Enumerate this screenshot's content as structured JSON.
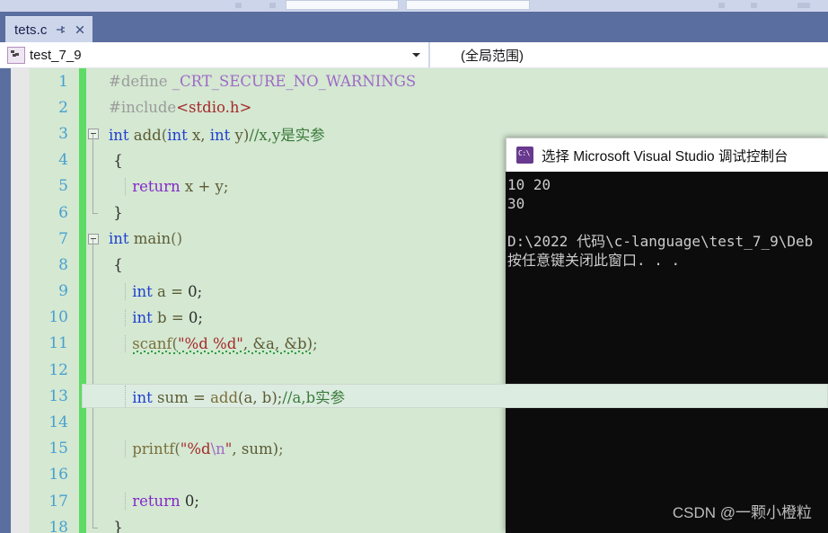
{
  "toolbar": {
    "visible_hint": "partial-toolbar-strip"
  },
  "tab": {
    "label": "tets.c",
    "pin_icon": "pin-icon",
    "close_icon": "close-icon"
  },
  "navbar": {
    "scope_left": "test_7_9",
    "scope_right": "(全局范围)",
    "member_icon": "member-icon",
    "caret_icon": "chevron-down-icon"
  },
  "editor": {
    "lines": [
      {
        "num": "1",
        "changed": true,
        "fold": "none",
        "indent_guides": 0,
        "tokens": [
          {
            "t": "#define ",
            "c": "c-pre"
          },
          {
            "t": "_CRT_SECURE_NO_WARNINGS",
            "c": "c-macro"
          }
        ]
      },
      {
        "num": "2",
        "changed": true,
        "fold": "none",
        "indent_guides": 0,
        "tokens": [
          {
            "t": "#include",
            "c": "c-pre"
          },
          {
            "t": "<stdio.h>",
            "c": "c-inc"
          }
        ]
      },
      {
        "num": "3",
        "changed": true,
        "fold": "open",
        "indent_guides": 0,
        "tokens": [
          {
            "t": "int ",
            "c": "c-kw"
          },
          {
            "t": "add",
            "c": "c-id"
          },
          {
            "t": "(",
            "c": "c-punct"
          },
          {
            "t": "int ",
            "c": "c-kw"
          },
          {
            "t": "x, ",
            "c": "c-id"
          },
          {
            "t": "int ",
            "c": "c-kw"
          },
          {
            "t": "y)",
            "c": "c-id"
          },
          {
            "t": "//x,y是实参",
            "c": "c-cmt"
          }
        ]
      },
      {
        "num": "4",
        "changed": true,
        "fold": "body",
        "indent_guides": 0,
        "tokens": [
          {
            "t": " {",
            "c": "c-plain"
          }
        ]
      },
      {
        "num": "5",
        "changed": true,
        "fold": "body",
        "indent_guides": 1,
        "tokens": [
          {
            "t": "     ",
            "c": "c-plain"
          },
          {
            "t": "return ",
            "c": "c-kwv"
          },
          {
            "t": "x + y;",
            "c": "c-id"
          }
        ]
      },
      {
        "num": "6",
        "changed": true,
        "fold": "end",
        "indent_guides": 0,
        "tokens": [
          {
            "t": " }",
            "c": "c-plain"
          }
        ]
      },
      {
        "num": "7",
        "changed": true,
        "fold": "open",
        "indent_guides": 0,
        "tokens": [
          {
            "t": "int ",
            "c": "c-kw"
          },
          {
            "t": "main",
            "c": "c-id"
          },
          {
            "t": "()",
            "c": "c-punct"
          }
        ]
      },
      {
        "num": "8",
        "changed": true,
        "fold": "body",
        "indent_guides": 0,
        "tokens": [
          {
            "t": " {",
            "c": "c-plain"
          }
        ]
      },
      {
        "num": "9",
        "changed": true,
        "fold": "body",
        "indent_guides": 1,
        "tokens": [
          {
            "t": "     ",
            "c": "c-plain"
          },
          {
            "t": "int ",
            "c": "c-kw"
          },
          {
            "t": "a = ",
            "c": "c-id"
          },
          {
            "t": "0;",
            "c": "c-num"
          }
        ]
      },
      {
        "num": "10",
        "changed": true,
        "fold": "body",
        "indent_guides": 1,
        "tokens": [
          {
            "t": "     ",
            "c": "c-plain"
          },
          {
            "t": "int ",
            "c": "c-kw"
          },
          {
            "t": "b = ",
            "c": "c-id"
          },
          {
            "t": "0;",
            "c": "c-num"
          }
        ]
      },
      {
        "num": "11",
        "changed": true,
        "fold": "body",
        "indent_guides": 1,
        "squiggle": true,
        "tokens": [
          {
            "t": "     ",
            "c": "c-plain"
          },
          {
            "t": "scanf",
            "c": "c-fn",
            "sq": true
          },
          {
            "t": "(",
            "c": "c-punct",
            "sq": true
          },
          {
            "t": "\"%d %d\"",
            "c": "c-str",
            "sq": true
          },
          {
            "t": ", &a, &b)",
            "c": "c-id",
            "sq": true
          },
          {
            "t": ";",
            "c": "c-punct"
          }
        ]
      },
      {
        "num": "12",
        "changed": true,
        "fold": "body",
        "indent_guides": 1,
        "tokens": [
          {
            "t": "",
            "c": "c-plain"
          }
        ]
      },
      {
        "num": "13",
        "changed": true,
        "fold": "body",
        "indent_guides": 1,
        "current": true,
        "tokens": [
          {
            "t": "     ",
            "c": "c-plain"
          },
          {
            "t": "int ",
            "c": "c-kw"
          },
          {
            "t": "sum = ",
            "c": "c-id"
          },
          {
            "t": "add",
            "c": "c-fn"
          },
          {
            "t": "(a, b);",
            "c": "c-id"
          },
          {
            "t": "//a,b实参",
            "c": "c-cmt"
          }
        ]
      },
      {
        "num": "14",
        "changed": true,
        "fold": "body",
        "indent_guides": 1,
        "tokens": [
          {
            "t": "",
            "c": "c-plain"
          }
        ]
      },
      {
        "num": "15",
        "changed": true,
        "fold": "body",
        "indent_guides": 1,
        "tokens": [
          {
            "t": "     ",
            "c": "c-plain"
          },
          {
            "t": "printf",
            "c": "c-fn"
          },
          {
            "t": "(",
            "c": "c-punct"
          },
          {
            "t": "\"%d",
            "c": "c-str"
          },
          {
            "t": "\\n",
            "c": "c-esc"
          },
          {
            "t": "\"",
            "c": "c-str"
          },
          {
            "t": ", sum)",
            "c": "c-id"
          },
          {
            "t": ";",
            "c": "c-punct"
          }
        ]
      },
      {
        "num": "16",
        "changed": true,
        "fold": "body",
        "indent_guides": 1,
        "tokens": [
          {
            "t": "",
            "c": "c-plain"
          }
        ]
      },
      {
        "num": "17",
        "changed": true,
        "fold": "body",
        "indent_guides": 1,
        "tokens": [
          {
            "t": "     ",
            "c": "c-plain"
          },
          {
            "t": "return ",
            "c": "c-kwv"
          },
          {
            "t": "0;",
            "c": "c-num"
          }
        ]
      },
      {
        "num": "18",
        "changed": true,
        "fold": "end",
        "indent_guides": 0,
        "tokens": [
          {
            "t": " }",
            "c": "c-plain"
          }
        ]
      }
    ]
  },
  "console": {
    "title": "选择 Microsoft Visual Studio 调试控制台",
    "icon": "console-icon",
    "lines": [
      "10 20",
      "30",
      "",
      "D:\\2022 代码\\c-language\\test_7_9\\Deb",
      "按任意键关闭此窗口. . ."
    ],
    "watermark": "CSDN @一颗小橙粒"
  },
  "colors": {
    "chrome_blue": "#5b6ea0",
    "tab_bg": "#ccd5ea",
    "editor_bg": "#d4e8d2",
    "change_bar": "#5ddb64",
    "console_bg": "#0c0c0c",
    "line_number": "#48a0cf"
  }
}
